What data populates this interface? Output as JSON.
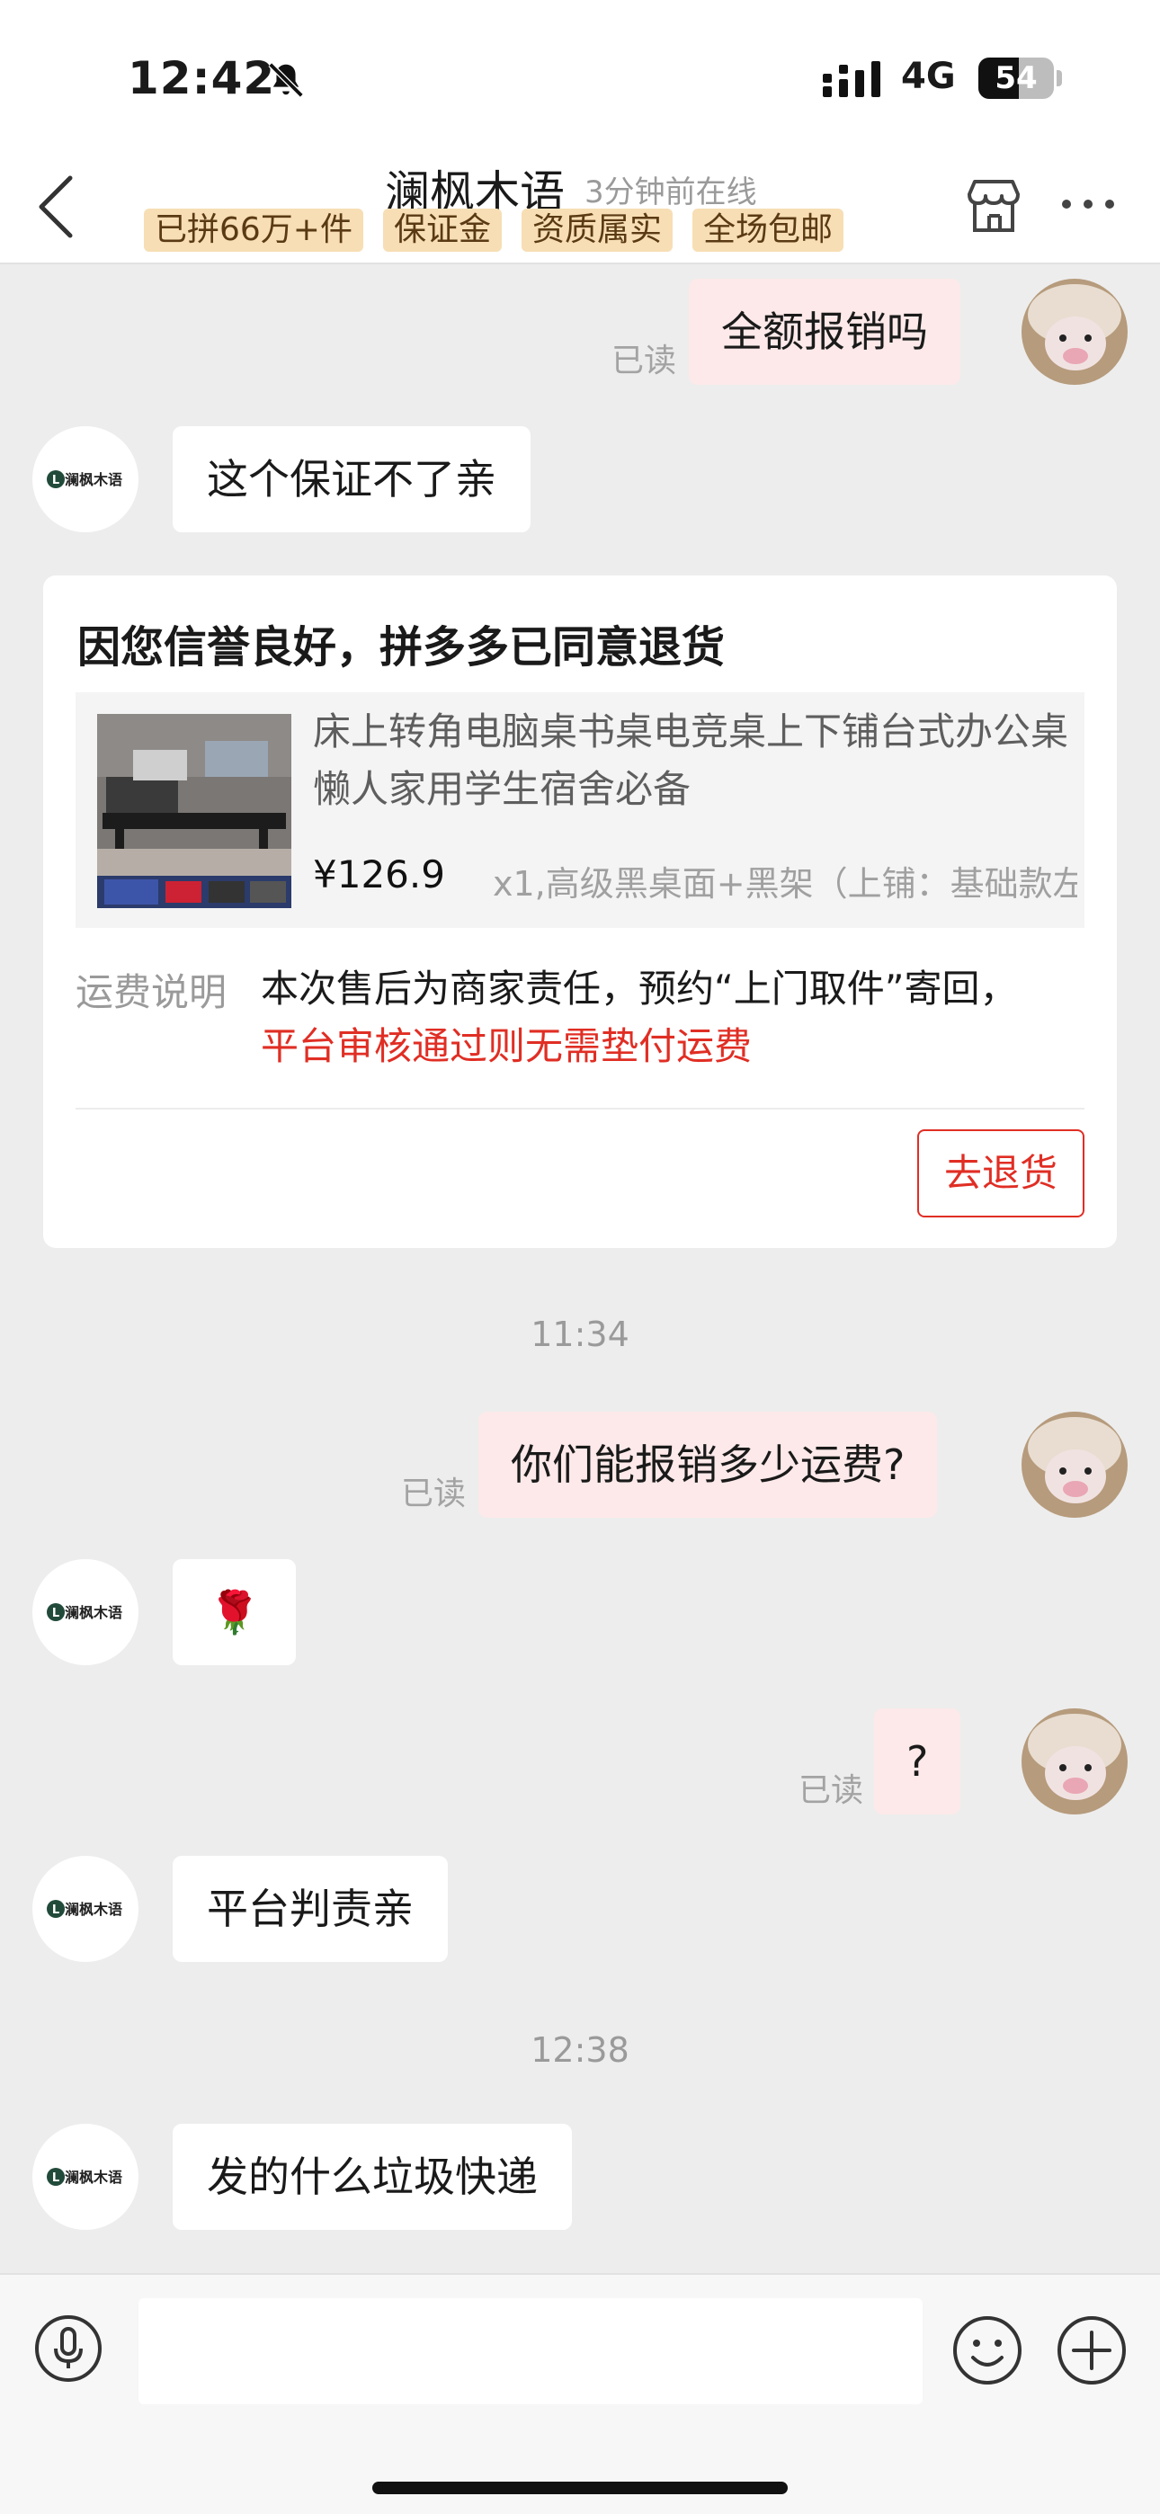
{
  "status_bar": {
    "time": "12:42",
    "network": "4G",
    "battery": "54"
  },
  "header": {
    "shop_name": "澜枫木语",
    "online_status": "3分钟前在线",
    "badges": [
      "已拼66万+件",
      "保证金",
      "资质属实",
      "全场包邮"
    ]
  },
  "messages": {
    "m1": {
      "text": "全额报销吗",
      "read": "已读"
    },
    "m2": {
      "text": "这个保证不了亲"
    },
    "m3": {
      "text": "你们能报销多少运费?",
      "read": "已读"
    },
    "m4": {
      "emoji": "🌹"
    },
    "m5": {
      "text": "?",
      "read": "已读"
    },
    "m6": {
      "text": "平台判责亲"
    },
    "m7": {
      "text": "发的什么垃圾快递"
    }
  },
  "timestamps": {
    "t1": "11:34",
    "t2": "12:38"
  },
  "card": {
    "title": "因您信誉良好，拼多多已同意退货",
    "product_title": "床上转角电脑桌书桌电竞桌上下铺台式办公桌懒人家用学生宿舍必备",
    "price": "¥126.9",
    "spec": "x1,高级黑桌面+黑架（上铺：基础款左",
    "shipping_label": "运费说明",
    "shipping_text": "本次售后为商家责任，预约“上门取件”寄回，",
    "shipping_red": "平台审核通过则无需垫付运费",
    "return_button": "去退货"
  },
  "shop_avatar": {
    "text": "澜枫木语",
    "letter": "L"
  },
  "colors": {
    "accent_red": "#e02e24",
    "my_bubble": "#fde9e9",
    "badge_bg": "#f7deb4",
    "background": "#ededed"
  },
  "input": {
    "placeholder": ""
  }
}
